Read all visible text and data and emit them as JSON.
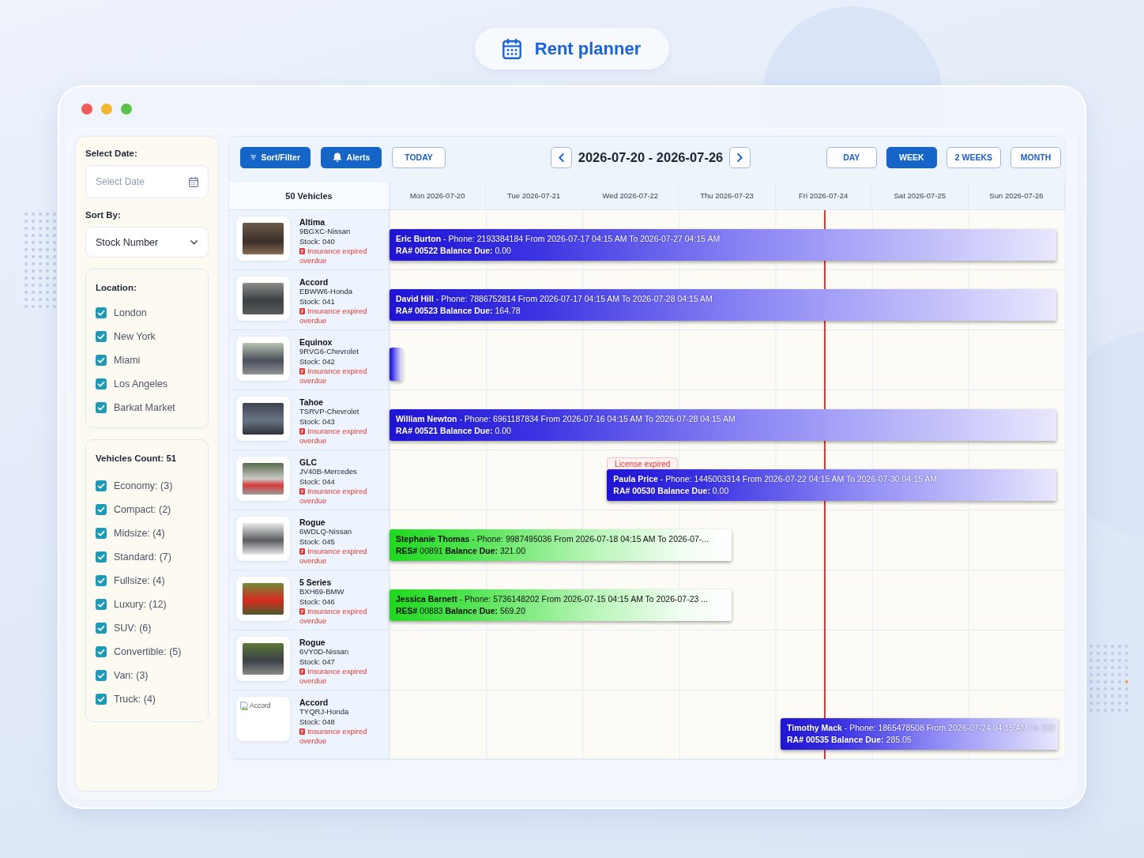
{
  "header": {
    "title": "Rent planner"
  },
  "sidebar": {
    "date_label": "Select Date:",
    "date_field": {
      "placeholder": "Select Date"
    },
    "sort_label": "Sort By:",
    "sort_select": {
      "value": "Stock Number"
    },
    "location": {
      "title": "Location:",
      "items": [
        {
          "label": "London",
          "checked": true
        },
        {
          "label": "New York",
          "checked": true
        },
        {
          "label": "Miami",
          "checked": true
        },
        {
          "label": "Los Angeles",
          "checked": true
        },
        {
          "label": "Barkat Market",
          "checked": true
        }
      ]
    },
    "vehicle_types": {
      "title": "Vehicles Count: 51",
      "items": [
        {
          "label": "Economy: (3)",
          "checked": true
        },
        {
          "label": "Compact: (2)",
          "checked": true
        },
        {
          "label": "Midsize: (4)",
          "checked": true
        },
        {
          "label": "Standard: (7)",
          "checked": true
        },
        {
          "label": "Fullsize: (4)",
          "checked": true
        },
        {
          "label": "Luxury: (12)",
          "checked": true
        },
        {
          "label": "SUV: (6)",
          "checked": true
        },
        {
          "label": "Convertible: (5)",
          "checked": true
        },
        {
          "label": "Van: (3)",
          "checked": true
        },
        {
          "label": "Truck: (4)",
          "checked": true
        }
      ]
    }
  },
  "toolbar": {
    "buttons": [
      {
        "kind": "filter",
        "label": "Sort/Filter"
      },
      {
        "kind": "alerts",
        "label": "Alerts"
      },
      {
        "kind": "today",
        "label": "TODAY"
      }
    ],
    "date_range": "2026-07-20 - 2026-07-26",
    "views": [
      {
        "label": "DAY",
        "selected": false
      },
      {
        "label": "WEEK",
        "selected": true
      },
      {
        "label": "2 WEEKS",
        "selected": false
      },
      {
        "label": "MONTH",
        "selected": false
      }
    ]
  },
  "planner": {
    "vehicle_header": "50 Vehicles",
    "days": [
      "Mon 2026-07-20",
      "Tue 2026-07-21",
      "Wed 2026-07-22",
      "Thu 2026-07-23",
      "Fri 2026-07-24",
      "Sat 2026-07-25",
      "Sun 2026-07-26"
    ],
    "rows": [
      {
        "vehicle": {
          "photo": {
            "kind": "photo"
          },
          "model": "Altima",
          "plate": "9BGXC-Nissan",
          "stock": "Stock: 040",
          "alert": "Insurance expired",
          "status": "overdue"
        },
        "booking": {
          "kind": "rental",
          "name": "Eric Burton",
          "details": "- Phone: 2193384184 From 2026-07-17 04:15 AM To 2026-07-27 04:15 AM",
          "ref_label": "RA#",
          "ref": "00522",
          "balance_label": "Balance Due:",
          "balance": "0.00"
        }
      },
      {
        "vehicle": {
          "photo": {
            "kind": "photo"
          },
          "model": "Accord",
          "plate": "EBWW6-Honda",
          "stock": "Stock: 041",
          "alert": "Insurance expired",
          "status": "overdue"
        },
        "booking": {
          "kind": "rental",
          "name": "David Hill",
          "details": "- Phone: 7886752814 From 2026-07-17 04:15 AM To 2026-07-28 04:15 AM",
          "ref_label": "RA#",
          "ref": "00523",
          "balance_label": "Balance Due:",
          "balance": "164.78"
        }
      },
      {
        "vehicle": {
          "photo": {
            "kind": "photo"
          },
          "model": "Equinox",
          "plate": "9RVG6-Chevrolet",
          "stock": "Stock: 042",
          "alert": "Insurance expired",
          "status": "overdue"
        },
        "booking": {
          "kind": "rental"
        }
      },
      {
        "vehicle": {
          "photo": {
            "kind": "photo"
          },
          "model": "Tahoe",
          "plate": "TSRVP-Chevrolet",
          "stock": "Stock: 043",
          "alert": "Insurance expired",
          "status": "overdue"
        },
        "booking": {
          "kind": "rental",
          "name": "William Newton",
          "details": "- Phone: 6961187834 From 2026-07-16 04:15 AM To 2026-07-28 04:15 AM",
          "ref_label": "RA#",
          "ref": "00521",
          "balance_label": "Balance Due:",
          "balance": "0.00"
        }
      },
      {
        "vehicle": {
          "photo": {
            "kind": "photo"
          },
          "model": "GLC",
          "plate": "JV40B-Mercedes",
          "stock": "Stock: 044",
          "alert": "Insurance expired",
          "status": "overdue"
        },
        "booking": {
          "kind": "rental",
          "tag": "License expired",
          "name": "Paula Price",
          "details": "- Phone: 1445003314 From 2026-07-22 04:15 AM To 2026-07-30 04:15 AM",
          "ref_label": "RA#",
          "ref": "00530",
          "balance_label": "Balance Due:",
          "balance": "0.00"
        }
      },
      {
        "vehicle": {
          "photo": {
            "kind": "photo"
          },
          "model": "Rogue",
          "plate": "6WDLQ-Nissan",
          "stock": "Stock: 045",
          "alert": "Insurance expired",
          "status": "overdue"
        },
        "booking": {
          "kind": "reservation",
          "name": "Stephanie Thomas",
          "details": "- Phone: 9987495036 From 2026-07-18 04:15 AM To 2026-07-...",
          "ref_label": "RES#",
          "ref": "00891",
          "balance_label": "Balance Due:",
          "balance": "321.00"
        }
      },
      {
        "vehicle": {
          "photo": {
            "kind": "photo"
          },
          "model": "5 Series",
          "plate": "BXH69-BMW",
          "stock": "Stock: 046",
          "alert": "Insurance expired",
          "status": "overdue"
        },
        "booking": {
          "kind": "reservation",
          "name": "Jessica Barnett",
          "details": "- Phone: 5736148202 From 2026-07-15 04:15 AM To 2026-07-23 ...",
          "ref_label": "RES#",
          "ref": "00883",
          "balance_label": "Balance Due:",
          "balance": "569.20"
        }
      },
      {
        "vehicle": {
          "photo": {
            "kind": "photo"
          },
          "model": "Rogue",
          "plate": "6VY0D-Nissan",
          "stock": "Stock: 047",
          "alert": "Insurance expired",
          "status": "overdue"
        }
      },
      {
        "vehicle": {
          "photo": {
            "kind": "broken",
            "alt": "Accord"
          },
          "model": "Accord",
          "plate": "TYQRJ-Honda",
          "stock": "Stock: 048",
          "alert": "Insurance expired",
          "status": "overdue"
        },
        "booking": {
          "kind": "rental",
          "name": "Timothy Mack",
          "details": "- Phone: 1865478508 From 2026-07-24 04:15 AM To 202",
          "ref_label": "RA#",
          "ref": "00535",
          "balance_label": "Balance Due:",
          "balance": "285.05"
        }
      }
    ]
  }
}
